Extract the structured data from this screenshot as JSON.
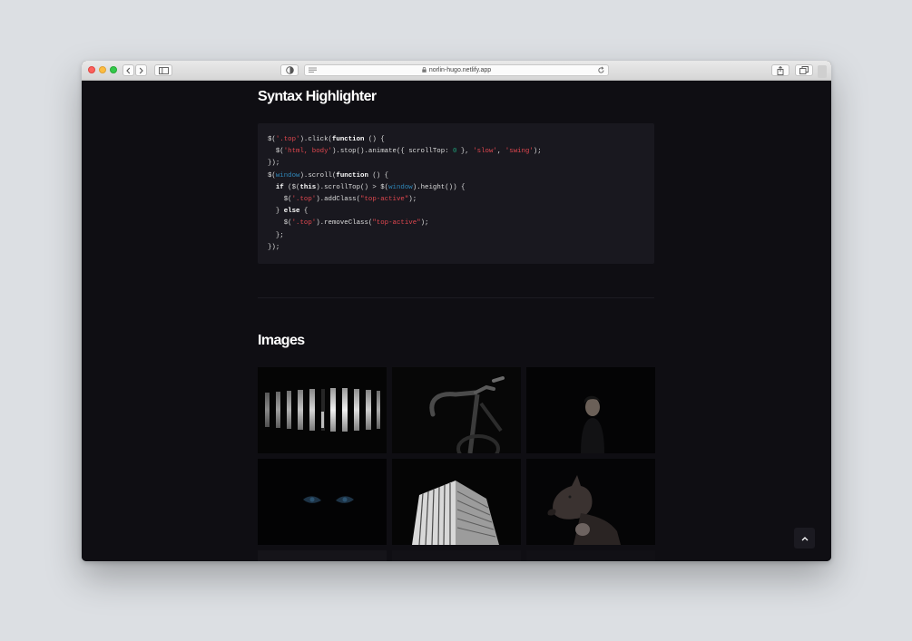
{
  "browser": {
    "url": "norlin-hugo.netlify.app",
    "icons": [
      "back-icon",
      "forward-icon",
      "sidebar-icon",
      "shield-icon",
      "reader-icon",
      "lock-icon",
      "reload-icon",
      "share-icon",
      "tabs-icon"
    ]
  },
  "page": {
    "syntax_title": "Syntax Highlighter",
    "images_title": "Images",
    "images": [
      {
        "name": "striped-light-bars"
      },
      {
        "name": "bicycle-handlebars"
      },
      {
        "name": "portrait-in-dark"
      },
      {
        "name": "eyes-in-dark"
      },
      {
        "name": "white-building"
      },
      {
        "name": "dog-portrait"
      }
    ]
  },
  "code": {
    "l1": {
      "a": "$(",
      "b": "'.top'",
      "c": ").click(",
      "d": "function",
      "e": " () {"
    },
    "l2": {
      "a": "  $(",
      "b": "'html, body'",
      "c": ").stop().animate({ scrollTop: ",
      "d": "0",
      "e": " }, ",
      "f": "'slow'",
      "g": ", ",
      "h": "'swing'",
      "i": ");"
    },
    "l3": "});",
    "l4": {
      "a": "$(",
      "b": "window",
      "c": ").scroll(",
      "d": "function",
      "e": " () {"
    },
    "l5": {
      "a": "  ",
      "b": "if",
      "c": " ($(",
      "d": "this",
      "e": ").scrollTop() > $(",
      "f": "window",
      "g": ").height()) {"
    },
    "l6": {
      "a": "    $(",
      "b": "'.top'",
      "c": ").addClass(",
      "d": "\"top-active\"",
      "e": ");"
    },
    "l7": {
      "a": "  } ",
      "b": "else",
      "c": " {"
    },
    "l8": {
      "a": "    $(",
      "b": "'.top'",
      "c": ").removeClass(",
      "d": "\"top-active\"",
      "e": ");"
    },
    "l9": "  };",
    "l10": "});"
  },
  "colors": {
    "background": "#0f0e13",
    "code_background": "#19181f",
    "keyword": "#ffffff",
    "string": "#e0474f",
    "number": "#1fa17a",
    "variable": "#2f86b8"
  }
}
